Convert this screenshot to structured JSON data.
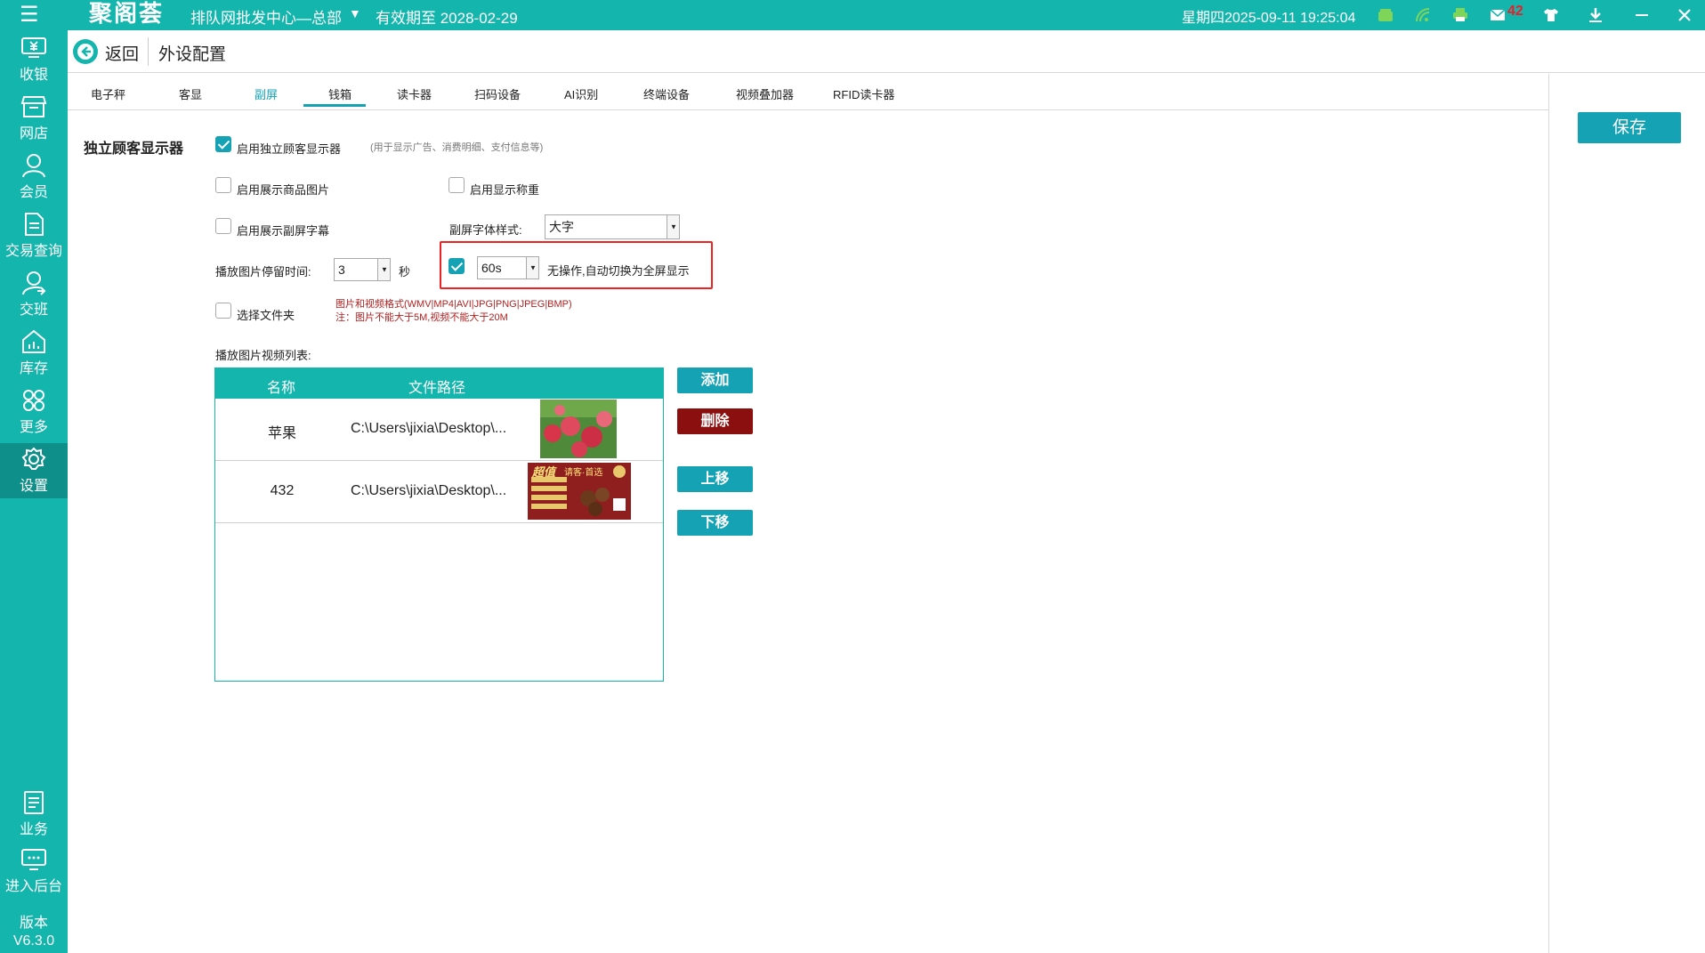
{
  "app": {
    "logo": "聚阁荟",
    "store": "排队网批发中心—总部",
    "expiry": "有效期至 2028-02-29",
    "clock": "星期四2025-09-11 19:25:04",
    "message_count": "42"
  },
  "topbar_icons": [
    "menu-icon",
    "store-icon",
    "wifi-icon",
    "printer-icon",
    "message-icon",
    "shirt-icon",
    "download-icon",
    "minimize-icon",
    "close-icon"
  ],
  "sidebar": {
    "items": [
      {
        "label": "收银",
        "icon": "cashier-icon"
      },
      {
        "label": "网店",
        "icon": "online-store-icon"
      },
      {
        "label": "会员",
        "icon": "member-icon"
      },
      {
        "label": "交易查询",
        "icon": "transaction-icon"
      },
      {
        "label": "交班",
        "icon": "shift-icon"
      },
      {
        "label": "库存",
        "icon": "inventory-icon"
      },
      {
        "label": "更多",
        "icon": "more-icon"
      },
      {
        "label": "设置",
        "icon": "settings-icon"
      },
      {
        "label": "业务",
        "icon": "business-icon"
      },
      {
        "label": "进入后台",
        "icon": "backend-icon"
      }
    ],
    "active": "设置",
    "version_label": "版本",
    "version": "V6.3.0"
  },
  "header": {
    "back_label": "返回",
    "title": "外设配置"
  },
  "save_label": "保存",
  "tabs": [
    {
      "label": "电子秤"
    },
    {
      "label": "客显"
    },
    {
      "label": "副屏"
    },
    {
      "label": "钱箱"
    },
    {
      "label": "读卡器"
    },
    {
      "label": "扫码设备"
    },
    {
      "label": "AI识别"
    },
    {
      "label": "终端设备"
    },
    {
      "label": "视频叠加器"
    },
    {
      "label": "RFID读卡器"
    }
  ],
  "active_tab": "副屏",
  "form": {
    "section_title": "独立顾客显示器",
    "enable_display": {
      "label": "启用独立顾客显示器",
      "checked": true
    },
    "enable_display_hint": "(用于显示广告、消费明细、支付信息等)",
    "show_product_images": {
      "label": "启用展示商品图片",
      "checked": false
    },
    "show_weight": {
      "label": "启用显示称重",
      "checked": false
    },
    "show_subtitles": {
      "label": "启用展示副屏字幕",
      "checked": false
    },
    "font_style_label": "副屏字体样式:",
    "font_style_value": "大字",
    "image_duration_label": "播放图片停留时间:",
    "image_duration_value": "3",
    "seconds_label": "秒",
    "auto_fullscreen": {
      "checked": true,
      "value": "60s",
      "label": "无操作,自动切换为全屏显示"
    },
    "select_folder": {
      "label": "选择文件夹",
      "checked": false
    },
    "format_note_1": "图片和视频格式(WMV|MP4|AVI|JPG|PNG|JPEG|BMP)",
    "format_note_2": "注：图片不能大于5M,视频不能大于20M",
    "list_title": "播放图片视频列表:"
  },
  "table": {
    "headers": [
      "名称",
      "文件路径"
    ],
    "rows": [
      {
        "name": "苹果",
        "path": "C:\\Users\\jixia\\Desktop\\..."
      },
      {
        "name": "432",
        "path": "C:\\Users\\jixia\\Desktop\\..."
      }
    ]
  },
  "buttons": {
    "add": "添加",
    "delete": "删除",
    "move_up": "上移",
    "move_down": "下移"
  },
  "thumb2": {
    "title_left": "超值",
    "title_right": "请客·首选"
  }
}
